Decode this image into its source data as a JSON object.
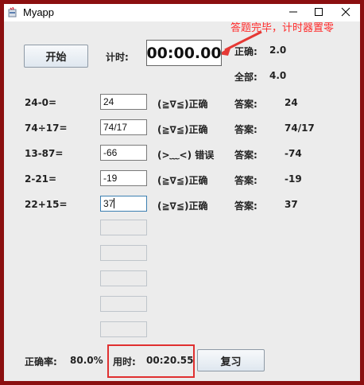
{
  "window": {
    "title": "Myapp"
  },
  "annotation": {
    "text": "答题完毕，计时器置零",
    "color": "#ff2a2a"
  },
  "top": {
    "start_label": "开始",
    "timer_label": "计时:",
    "timer_value": "00:00.00",
    "correct_label": "正确:",
    "correct_value": "2.0",
    "total_label": "全部:",
    "total_value": "4.0"
  },
  "rows": [
    {
      "question": "24-0=",
      "answer_input": "24",
      "status": "(≧∇≦)正确",
      "answer_label": "答案:",
      "answer": "24"
    },
    {
      "question": "74÷17=",
      "answer_input": "74/17",
      "status": "(≧∇≦)正确",
      "answer_label": "答案:",
      "answer": "74/17"
    },
    {
      "question": "13-87=",
      "answer_input": "-66",
      "status": "(>﹏<) 错误",
      "answer_label": "答案:",
      "answer": "-74"
    },
    {
      "question": "2-21=",
      "answer_input": "-19",
      "status": "(≧∇≦)正确",
      "answer_label": "答案:",
      "answer": "-19"
    },
    {
      "question": "22+15=",
      "answer_input": "37",
      "status": "(≧∇≦)正确",
      "answer_label": "答案:",
      "answer": "37"
    }
  ],
  "bottom": {
    "rate_label": "正确率:",
    "rate_value": "80.0%",
    "elapsed_label": "用时:",
    "elapsed_value": "00:20.55",
    "review_label": "复习"
  }
}
